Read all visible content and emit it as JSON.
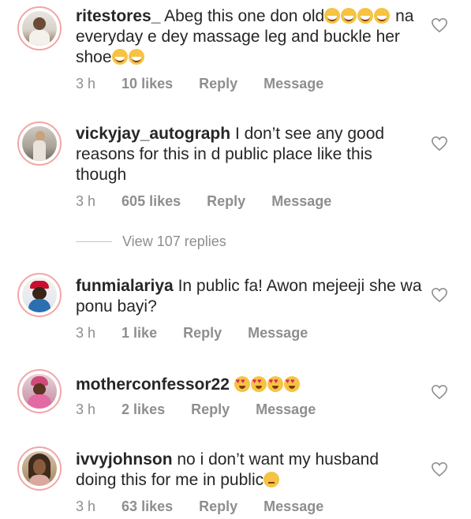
{
  "comments": [
    {
      "username": "ritestores_",
      "text": "Abeg this one don old",
      "emojis": [
        "grinning-squinting-face",
        "grinning-squinting-face",
        "grinning-squinting-face",
        "grinning-squinting-face"
      ],
      "text2": "na everyday e dey massage leg and buckle her shoe",
      "emojis2": [
        "grinning-squinting-face",
        "grinning-squinting-face"
      ],
      "time": "3 h",
      "likes": "10 likes",
      "reply": "Reply",
      "message": "Message"
    },
    {
      "username": "vickyjay_autograph",
      "text": "I don’t see any good reasons for this in d public place like this though",
      "time": "3 h",
      "likes": "605 likes",
      "reply": "Reply",
      "message": "Message"
    },
    {
      "username": "funmialariya",
      "text": "In public fa! Awon mejeeji she wa ponu bayi?",
      "time": "3 h",
      "likes": "1 like",
      "reply": "Reply",
      "message": "Message"
    },
    {
      "username": "motherconfessor22",
      "text": "",
      "emojis": [
        "heart-eyes-face",
        "heart-eyes-face",
        "heart-eyes-face",
        "heart-eyes-face"
      ],
      "time": "3 h",
      "likes": "2 likes",
      "reply": "Reply",
      "message": "Message"
    },
    {
      "username": "ivvyjohnson",
      "text": "no i don’t want my husband doing this for me in public",
      "emojis": [
        "unamused-face"
      ],
      "time": "3 h",
      "likes": "63 likes",
      "reply": "Reply",
      "message": "Message"
    }
  ],
  "view_replies": "View 107 replies",
  "icons": {
    "like": "heart-outline-icon"
  },
  "colors": {
    "text": "#262626",
    "muted": "#8e8e8e",
    "avatar_ring": "#f2a6a6"
  }
}
